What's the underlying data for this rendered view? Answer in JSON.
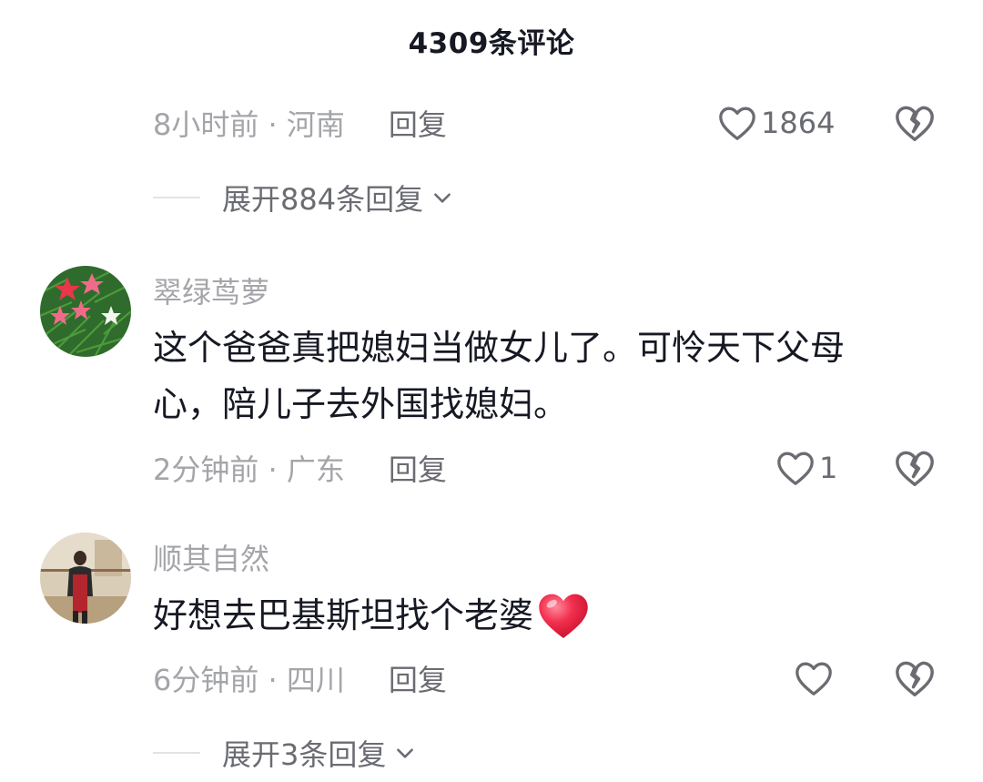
{
  "header": {
    "title": "4309条评论"
  },
  "top_comment": {
    "time": "8小时前 · 河南",
    "reply_label": "回复",
    "likes": "1864",
    "expand_label": "展开884条回复"
  },
  "comments": [
    {
      "username": "翠绿茑萝",
      "text_line1": "这个爸爸真把媳妇当做女儿了。可怜天下父母",
      "text_line2": "心，陪儿子去外国找媳妇。",
      "time": "2分钟前 · 广东",
      "reply_label": "回复",
      "likes": "1"
    },
    {
      "username": "顺其自然",
      "text": "好想去巴基斯坦找个老婆",
      "emoji": "red-heart",
      "time": "6分钟前 · 四川",
      "reply_label": "回复",
      "likes": "",
      "expand_label": "展开3条回复"
    }
  ],
  "colors": {
    "text_primary": "#161823",
    "text_secondary": "#a4a5a9",
    "text_tertiary": "#6b6c72",
    "heart_red": "#f2304f"
  }
}
